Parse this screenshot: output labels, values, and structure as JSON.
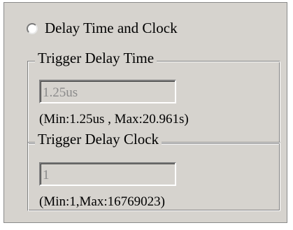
{
  "radio": {
    "label": "Delay Time and Clock",
    "checked": false
  },
  "trigger_delay_time": {
    "title": "Trigger Delay Time",
    "value": "1.25us",
    "range": "(Min:1.25us , Max:20.961s)"
  },
  "trigger_delay_clock": {
    "title": "Trigger Delay Clock",
    "value": "1",
    "range": "(Min:1,Max:16769023)"
  }
}
